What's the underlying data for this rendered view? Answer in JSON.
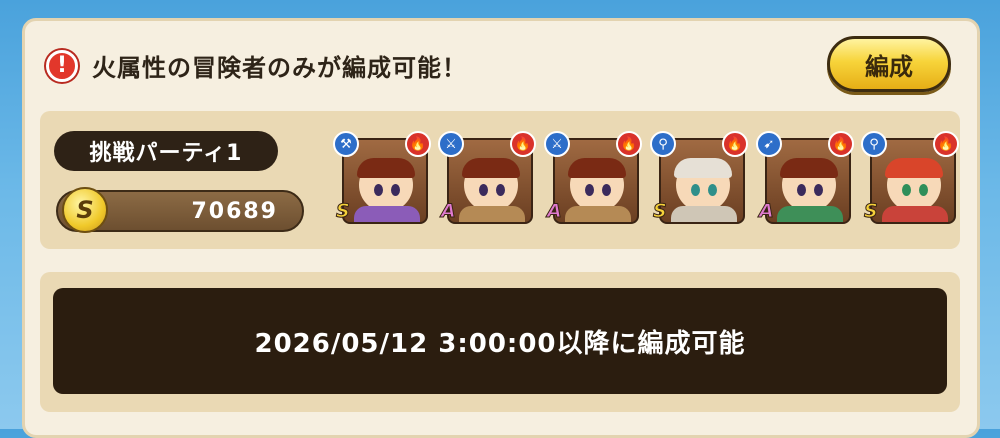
{
  "notice": {
    "icon": "exclamation-icon",
    "icon_glyph": "!",
    "text": "火属性の冒険者のみが編成可能！"
  },
  "buttons": {
    "formation": "編成"
  },
  "party": {
    "name": "挑戦パーティ1",
    "rank_badge": "S",
    "power": "70689",
    "members": [
      {
        "rank": "S",
        "weapon_icon": "axe-icon",
        "weapon_glyph": "⚒",
        "element_icon": "fire-icon",
        "element_glyph": "🔥"
      },
      {
        "rank": "A",
        "weapon_icon": "sword-icon",
        "weapon_glyph": "⚔",
        "element_icon": "fire-icon",
        "element_glyph": "🔥"
      },
      {
        "rank": "A",
        "weapon_icon": "sword-icon",
        "weapon_glyph": "⚔",
        "element_icon": "fire-icon",
        "element_glyph": "🔥"
      },
      {
        "rank": "S",
        "weapon_icon": "staff-icon",
        "weapon_glyph": "⚲",
        "element_icon": "fire-icon",
        "element_glyph": "🔥"
      },
      {
        "rank": "A",
        "weapon_icon": "bow-icon",
        "weapon_glyph": "➹",
        "element_icon": "fire-icon",
        "element_glyph": "🔥"
      },
      {
        "rank": "S",
        "weapon_icon": "wand-icon",
        "weapon_glyph": "⚲",
        "element_icon": "fire-icon",
        "element_glyph": "🔥"
      }
    ]
  },
  "availability": {
    "message": "2026/05/12 3:00:00以降に編成可能"
  },
  "colors": {
    "accent_gold": "#f7d43a",
    "warning_red": "#e2372b",
    "dark_panel": "#2b1d0f"
  }
}
